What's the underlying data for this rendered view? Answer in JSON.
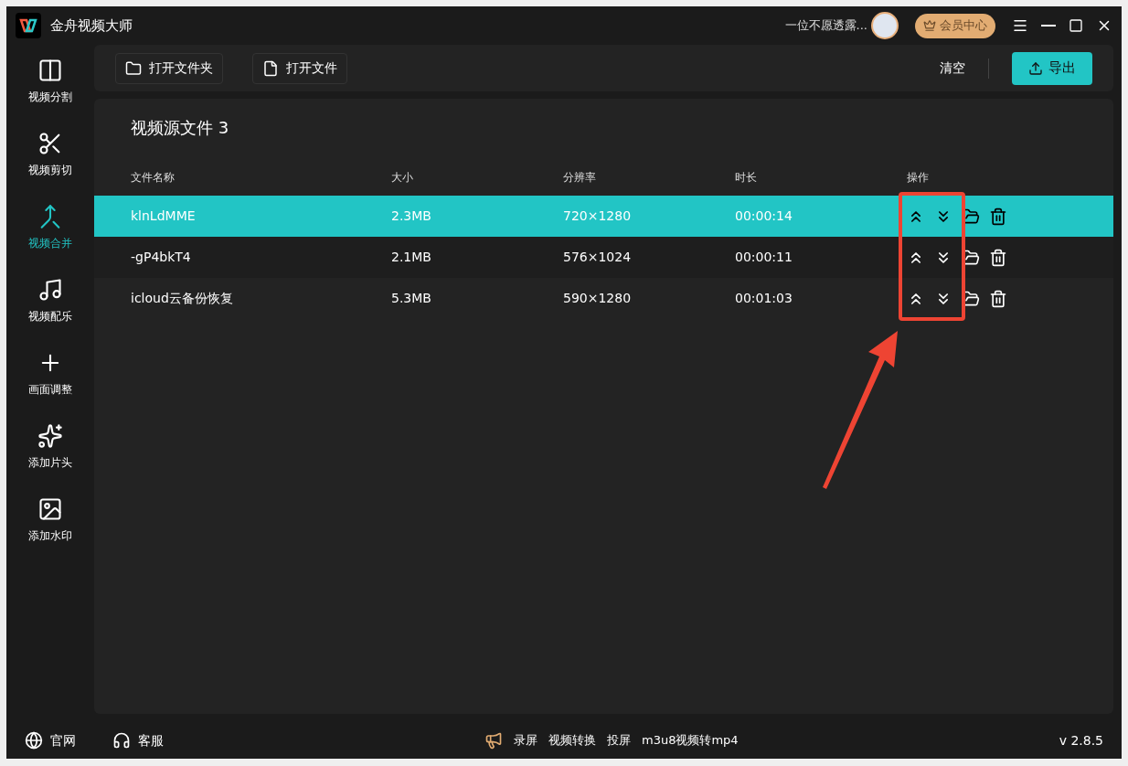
{
  "app": {
    "title": "金舟视频大师"
  },
  "account": {
    "user_name": "一位不愿透露...",
    "vip_button": "会员中心"
  },
  "sidebar": {
    "items": [
      {
        "label": "视频分割",
        "selected": false
      },
      {
        "label": "视频剪切",
        "selected": false
      },
      {
        "label": "视频合并",
        "selected": true
      },
      {
        "label": "视频配乐",
        "selected": false
      },
      {
        "label": "画面调整",
        "selected": false
      },
      {
        "label": "添加片头",
        "selected": false
      },
      {
        "label": "添加水印",
        "selected": false
      }
    ]
  },
  "toolbar": {
    "open_folder": "打开文件夹",
    "open_file": "打开文件",
    "clear": "清空",
    "export": "导出"
  },
  "files": {
    "title": "视频源文件 3",
    "columns": [
      "文件名称",
      "大小",
      "分辨率",
      "时长",
      "操作"
    ],
    "rows": [
      {
        "name": "klnLdMME",
        "size": "2.3MB",
        "resolution": "720×1280",
        "duration": "00:00:14",
        "selected": true
      },
      {
        "name": "-gP4bkT4",
        "size": "2.1MB",
        "resolution": "576×1024",
        "duration": "00:00:11",
        "selected": false
      },
      {
        "name": "icloud云备份恢复",
        "size": "5.3MB",
        "resolution": "590×1280",
        "duration": "00:01:03",
        "selected": false
      }
    ]
  },
  "footer": {
    "left": [
      "官网",
      "客服"
    ],
    "links": [
      "录屏",
      "视频转换",
      "投屏",
      "m3u8视频转mp4"
    ],
    "version": "v 2.8.5"
  }
}
